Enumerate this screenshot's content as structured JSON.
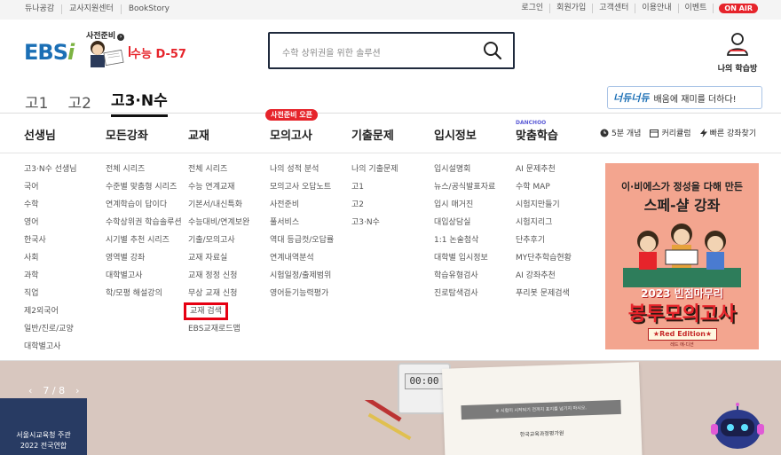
{
  "topbar": {
    "left_links": [
      "듀나공감",
      "교사지원센터",
      "BookStory"
    ],
    "right_links": [
      "로그인",
      "회원가입",
      "고객센터",
      "이용안내",
      "이벤트"
    ],
    "onair": "ON AIR"
  },
  "header": {
    "logo_text": "EBS",
    "logo_i": "i",
    "preview_label": "사전준비",
    "dday": "수능 D-57",
    "search_placeholder": "수학 상위권을 위한 솔루션",
    "mystudy": "나의 학습방"
  },
  "grades": [
    "고1",
    "고2",
    "고3·N수"
  ],
  "banner_right": {
    "brand": "너듀너듀",
    "text": "배움에 재미를 더하다!"
  },
  "mainnav": {
    "items": [
      "선생님",
      "모든강좌",
      "교재",
      "모의고사",
      "기출문제",
      "입시정보",
      "맞춤학습"
    ],
    "mock_badge": "사전준비 오픈",
    "danchoo": "DANCHOO",
    "quick": [
      "5분 개념",
      "커리큘럼",
      "빠른 강좌찾기"
    ]
  },
  "menu": {
    "teachers": [
      "고3·N수 선생님",
      "국어",
      "수학",
      "영어",
      "한국사",
      "사회",
      "과학",
      "직업",
      "제2외국어",
      "일반/진로/교양",
      "대학별고사"
    ],
    "courses": [
      "전체 시리즈",
      "수준별 맞춤형 시리즈",
      "연계학습이 답이다",
      "수학상위권 학습솔루션",
      "시기별 추천 시리즈",
      "영역별 강좌",
      "대학별고사",
      "학/모평 해설강의"
    ],
    "books": [
      "전체 시리즈",
      "수능 연계교재",
      "기본서/내신특화",
      "수능대비/연계보완",
      "기출/모의고사",
      "교재 자료실",
      "교재 정정 신청",
      "무상 교재 신청",
      "교재 검색",
      "EBS교재로드맵"
    ],
    "mock": [
      "나의 성적 분석",
      "모의고사 오답노트",
      "사전준비",
      "풀서비스",
      "역대 등급컷/오답률",
      "연계내역분석",
      "시험일정/출제범위",
      "영어듣기능력평가"
    ],
    "past": [
      "나의 기출문제",
      "고1",
      "고2",
      "고3·N수"
    ],
    "admission": [
      "입시설명회",
      "뉴스/공식발표자료",
      "입시 매거진",
      "대입상담실",
      "1:1 논술첨삭",
      "대학별 입시정보",
      "학습유형검사",
      "진로탐색검사"
    ],
    "custom": [
      "AI 문제추천",
      "수학 MAP",
      "시험지만들기",
      "시험지리그",
      "단추후기",
      "MY단추학습현황",
      "AI 강좌추천",
      "푸리봇 문제검색"
    ]
  },
  "promo": {
    "line1": "이·비에스가 정성을 다해 만든",
    "line2": "스페-샬 강좌",
    "line3": "2023 빈점마무리",
    "line4": "봉투모의고사",
    "edition": "★Red Edition★",
    "edition_kr": "레드 에-디션"
  },
  "hero": {
    "pager": "7 / 8",
    "box_line1": "서울시교육청 주관",
    "box_line2": "2022 전국연합",
    "timer": "00:00",
    "strip": "※ 시험이 시작되기 전까지 표지를 넘기지 마시오.",
    "org": "한국교육과정평가원"
  },
  "colors": {
    "brand_blue": "#1b6fb5",
    "accent_red": "#e6242b",
    "promo_bg": "#f3a58f"
  }
}
